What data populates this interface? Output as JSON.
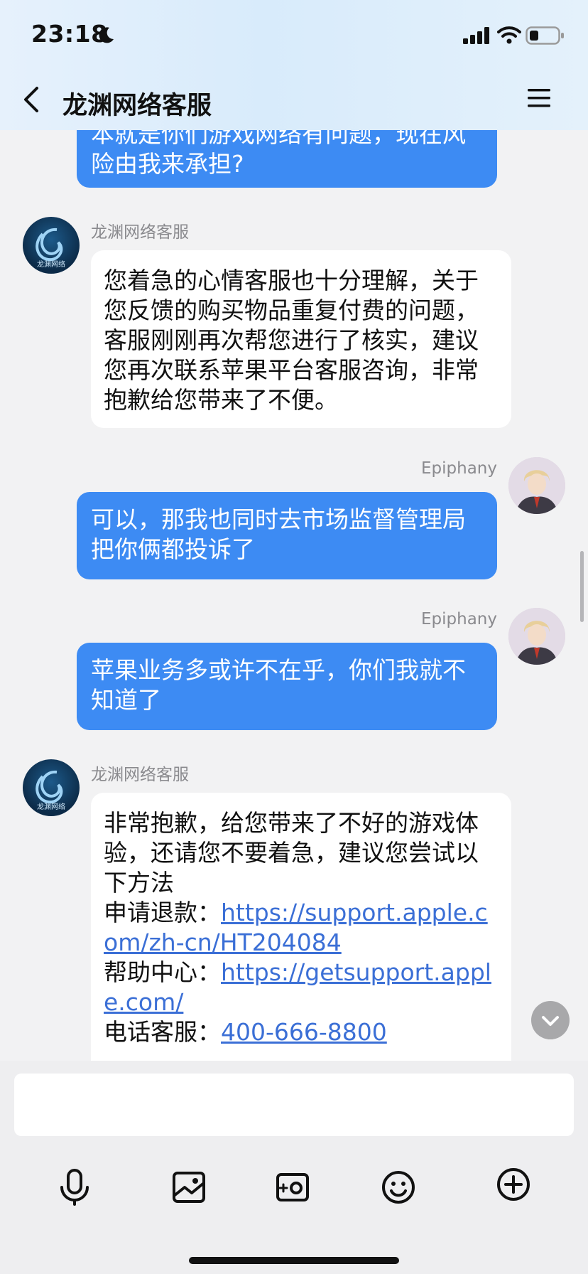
{
  "status_bar": {
    "time": "23:18"
  },
  "header": {
    "title": "龙渊网络客服"
  },
  "messages": {
    "m0": {
      "text": "本就是你们游戏网络有问题，现在风险由我来承担?"
    },
    "m1": {
      "sender": "龙渊网络客服",
      "avatar_text": "龙渊网络",
      "text": "您着急的心情客服也十分理解，关于您反馈的购买物品重复付费的问题，客服刚刚再次帮您进行了核实，建议您再次联系苹果平台客服咨询，非常抱歉给您带来了不便。"
    },
    "m2": {
      "sender": "Epiphany",
      "text": "可以，那我也同时去市场监督管理局把你俩都投诉了"
    },
    "m3": {
      "sender": "Epiphany",
      "text": "苹果业务多或许不在乎，你们我就不知道了"
    },
    "m4": {
      "sender": "龙渊网络客服",
      "avatar_text": "龙渊网络",
      "intro": "非常抱歉，给您带来了不好的游戏体验，还请您不要着急，建议您尝试以下方法",
      "refund_label": "申请退款：",
      "refund_url": "https://support.apple.com/zh-cn/HT204084",
      "help_label": "帮助中心：",
      "help_url": "https://getsupport.apple.com/",
      "phone_label": "电话客服：",
      "phone": "400-666-8800"
    }
  },
  "input": {
    "placeholder": ""
  },
  "toolbar": [
    "microphone-icon",
    "image-icon",
    "camera-icon",
    "emoji-icon",
    "plus-icon"
  ]
}
